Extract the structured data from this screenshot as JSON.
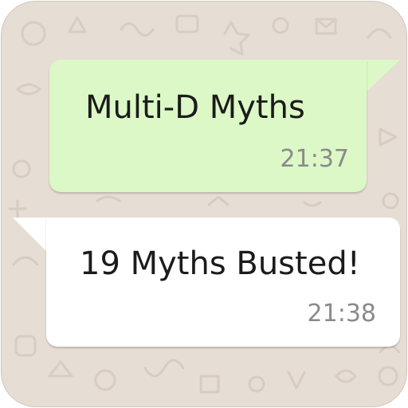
{
  "chat": {
    "messages": [
      {
        "direction": "outgoing",
        "text": "Multi-D Myths",
        "time": "21:37"
      },
      {
        "direction": "incoming",
        "text": "19 Myths Busted!",
        "time": "21:38"
      }
    ]
  },
  "colors": {
    "wallpaper": "#e6ddd4",
    "outgoing_bubble": "#dcf8c6",
    "incoming_bubble": "#ffffff",
    "timestamp": "#8a8a8a"
  }
}
